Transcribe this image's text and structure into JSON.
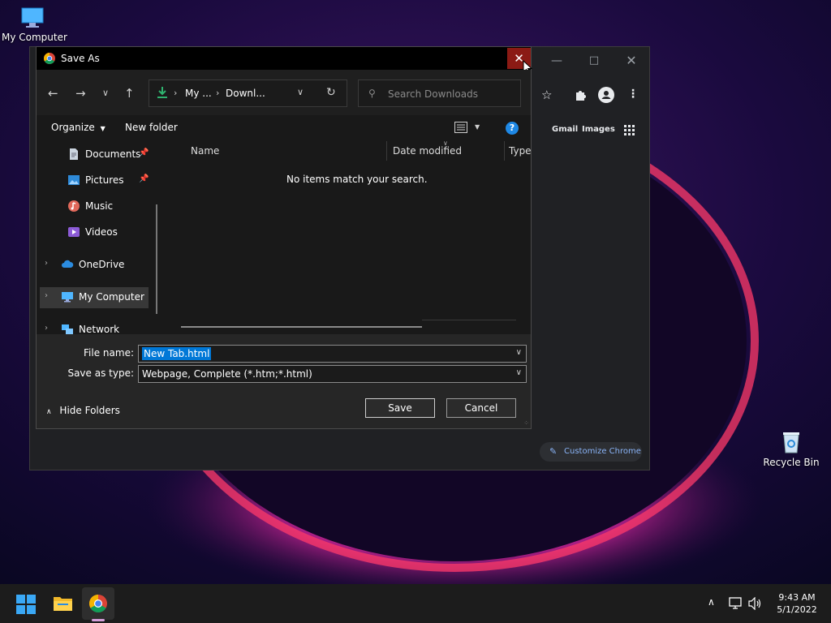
{
  "desktop": {
    "icons": [
      {
        "label": "My Computer"
      },
      {
        "label": "Recycle Bin"
      }
    ]
  },
  "chrome_window": {
    "links": {
      "gmail": "Gmail",
      "images": "Images"
    },
    "customize_label": "Customize Chrome"
  },
  "dialog": {
    "title": "Save As",
    "breadcrumb": [
      "My ...",
      "Downl..."
    ],
    "search_placeholder": "Search Downloads",
    "commands": {
      "organize": "Organize",
      "new_folder": "New folder"
    },
    "nav_items": [
      {
        "label": "Documents",
        "icon": "documents-icon",
        "pinned": true
      },
      {
        "label": "Pictures",
        "icon": "pictures-icon",
        "pinned": true
      },
      {
        "label": "Music",
        "icon": "music-icon"
      },
      {
        "label": "Videos",
        "icon": "videos-icon"
      },
      {
        "label": "OneDrive",
        "icon": "cloud-icon"
      },
      {
        "label": "My Computer",
        "icon": "computer-icon",
        "selected": true
      },
      {
        "label": "Network",
        "icon": "network-icon"
      }
    ],
    "columns": [
      "Name",
      "Date modified",
      "Type"
    ],
    "empty_message": "No items match your search.",
    "file_name_label": "File name:",
    "file_name_value": "New Tab.html",
    "save_type_label": "Save as type:",
    "save_type_value": "Webpage, Complete (*.htm;*.html)",
    "save_label": "Save",
    "cancel_label": "Cancel",
    "hide_folders_label": "Hide Folders"
  },
  "taskbar": {
    "time": "9:43 AM",
    "date": "5/1/2022"
  },
  "colors": {
    "accent": "#0078d7",
    "close_hover": "#8b1a14",
    "help": "#1e88e5"
  }
}
